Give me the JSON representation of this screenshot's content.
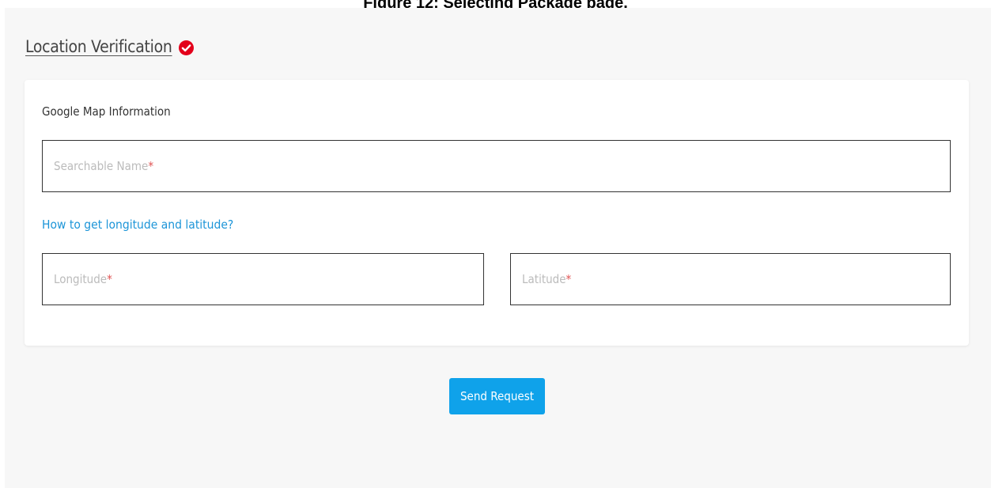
{
  "caption": "Figure 12: Selecting Package page.",
  "section": {
    "title": "Location Verification",
    "status_icon": "check-circle-icon",
    "status_color": "#e3001b"
  },
  "card": {
    "heading": "Google Map Information",
    "searchable_name": {
      "placeholder": "Searchable Name",
      "required_mark": "*",
      "value": ""
    },
    "help_link": "How to get longitude and latitude?",
    "longitude": {
      "placeholder": "Longitude",
      "required_mark": "*",
      "value": ""
    },
    "latitude": {
      "placeholder": "Latitude",
      "required_mark": "*",
      "value": ""
    }
  },
  "actions": {
    "send_label": "Send Request",
    "accent": "#0fa2ea"
  }
}
